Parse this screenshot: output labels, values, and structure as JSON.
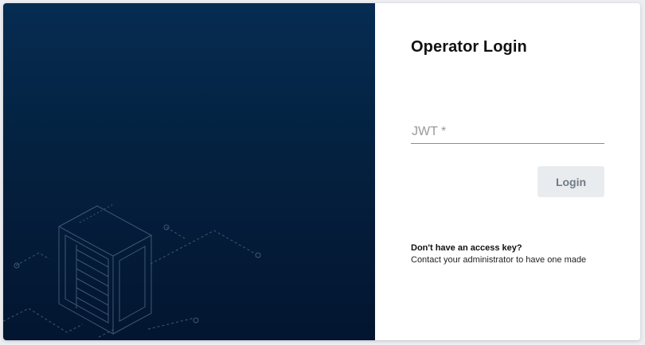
{
  "login": {
    "title": "Operator Login",
    "jwt_placeholder": "JWT *",
    "jwt_value": "",
    "button_label": "Login",
    "help_heading": "Don't have an access key?",
    "help_text": "Contact your administrator to have one made"
  },
  "colors": {
    "panel_dark": "#04213f",
    "button_bg": "#e9ecef",
    "button_text": "#707a84",
    "line_art": "#3e5874"
  },
  "icons": {
    "hero_illustration": "server-rack-icon"
  }
}
